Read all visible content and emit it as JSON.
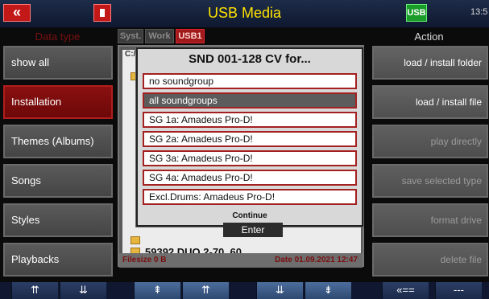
{
  "header": {
    "back_label": "«",
    "title": "USB Media",
    "usb_indicator": "USB",
    "time": "13:5"
  },
  "left": {
    "caption": "Data type",
    "items": [
      "show all",
      "Installation",
      "Themes (Albums)",
      "Songs",
      "Styles",
      "Playbacks"
    ],
    "active_index": 1
  },
  "tabs": [
    "Syst.",
    "Work",
    "USB1"
  ],
  "file": {
    "path": "C:/I",
    "rows": [
      {
        "label": "59392 DUO 2-70_60"
      }
    ],
    "filesize": "Filesize 0 B",
    "date": "Date 01.09.2021   12:47"
  },
  "right": {
    "caption": "Action",
    "buttons": [
      "load  /  install folder",
      "load  /  install file",
      "play directly",
      "save selected type",
      "format drive",
      "delete file"
    ]
  },
  "dialog": {
    "title": "SND 001-128 CV  for...",
    "options": [
      "no soundgroup",
      "all soundgroups",
      "SG 1a:  Amadeus Pro-D!",
      "SG 2a:  Amadeus Pro-D!",
      "SG 3a:  Amadeus Pro-D!",
      "SG 4a:  Amadeus Pro-D!",
      "Excl.Drums:  Amadeus Pro-D!"
    ],
    "selected_index": 1,
    "continue_label": "Continue",
    "enter_label": "Enter"
  },
  "bottom": [
    "⇈",
    "⇊",
    "⇞",
    "⇈",
    "⇊",
    "⇟",
    "«==",
    "---"
  ],
  "colors": {
    "accent_red": "#a01a1a",
    "title_yellow": "#ffe200"
  }
}
